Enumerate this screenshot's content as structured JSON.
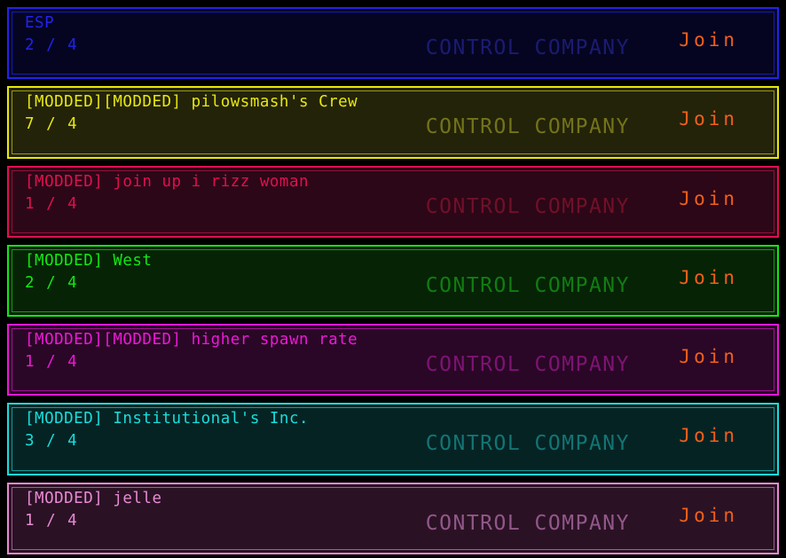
{
  "screen": {
    "name": "lobby-browser",
    "background": "#000000",
    "join_label": "Join",
    "watermark_label": "CONTROL COMPANY",
    "join_color": "#f2601a"
  },
  "lobbies": [
    {
      "title": "ESP",
      "count": "2 / 4",
      "players": 2,
      "max_players": 4,
      "join_label": "Join",
      "watermark": "CONTROL COMPANY",
      "accent": "#2222ee",
      "accent_inner": "#1a1ab4",
      "background": "#050522",
      "watermark_color": "#1b1b72"
    },
    {
      "title": "[MODDED][MODDED] pilowsmash's Crew",
      "count": "7 / 4",
      "players": 7,
      "max_players": 4,
      "join_label": "Join",
      "watermark": "CONTROL COMPANY",
      "accent": "#e8e80f",
      "accent_inner": "#9a9a10",
      "background": "#23230a",
      "watermark_color": "#73731a"
    },
    {
      "title": "[MODDED] join up i rizz woman",
      "count": "1 / 4",
      "players": 1,
      "max_players": 4,
      "join_label": "Join",
      "watermark": "CONTROL COMPANY",
      "accent": "#e01050",
      "accent_inner": "#95103a",
      "background": "#2c0717",
      "watermark_color": "#711029"
    },
    {
      "title": "[MODDED] West",
      "count": "2 / 4",
      "players": 2,
      "max_players": 4,
      "join_label": "Join",
      "watermark": "CONTROL COMPANY",
      "accent": "#13e813",
      "accent_inner": "#109e10",
      "background": "#062306",
      "watermark_color": "#127c12"
    },
    {
      "title": "[MODDED][MODDED] higher spawn rate",
      "count": "1 / 4",
      "players": 1,
      "max_players": 4,
      "join_label": "Join",
      "watermark": "CONTROL COMPANY",
      "accent": "#ed18d8",
      "accent_inner": "#a3139a",
      "background": "#2a0726",
      "watermark_color": "#7d1473"
    },
    {
      "title": "[MODDED] Institutional's Inc.",
      "count": "3 / 4",
      "players": 3,
      "max_players": 4,
      "join_label": "Join",
      "watermark": "CONTROL COMPANY",
      "accent": "#18dede",
      "accent_inner": "#139d9d",
      "background": "#062323",
      "watermark_color": "#137474"
    },
    {
      "title": "[MODDED] jelle",
      "count": "1 / 4",
      "players": 1,
      "max_players": 4,
      "join_label": "Join",
      "watermark": "CONTROL COMPANY",
      "accent": "#e88ad4",
      "accent_inner": "#a05d92",
      "background": "#2a1224",
      "watermark_color": "#92578a"
    }
  ]
}
